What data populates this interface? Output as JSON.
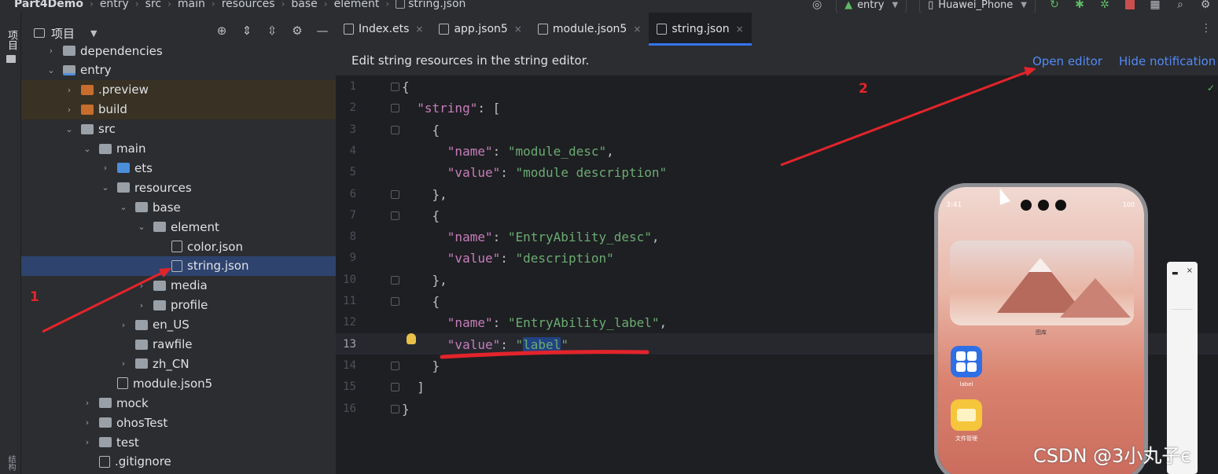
{
  "breadcrumbs": [
    "Part4Demo",
    "entry",
    "src",
    "main",
    "resources",
    "base",
    "element",
    "string.json"
  ],
  "toolbar": {
    "module_combo": "entry",
    "device_combo": "Huawei_Phone"
  },
  "left_strip": {
    "project_label": "项目",
    "bottom_label": "结构"
  },
  "project_panel": {
    "title": "项目",
    "tree": [
      {
        "label": "dependencies",
        "arrow": "›",
        "depth": 1,
        "icon": "grey"
      },
      {
        "label": "entry",
        "arrow": "⌄",
        "depth": 1,
        "icon": "grey-mod"
      },
      {
        "label": ".preview",
        "arrow": "›",
        "depth": 2,
        "icon": "orange"
      },
      {
        "label": "build",
        "arrow": "›",
        "depth": 2,
        "icon": "orange"
      },
      {
        "label": "src",
        "arrow": "⌄",
        "depth": 2,
        "icon": "grey"
      },
      {
        "label": "main",
        "arrow": "⌄",
        "depth": 3,
        "icon": "grey"
      },
      {
        "label": "ets",
        "arrow": "›",
        "depth": 4,
        "icon": "blue"
      },
      {
        "label": "resources",
        "arrow": "⌄",
        "depth": 4,
        "icon": "grey"
      },
      {
        "label": "base",
        "arrow": "⌄",
        "depth": 5,
        "icon": "grey"
      },
      {
        "label": "element",
        "arrow": "⌄",
        "depth": 6,
        "icon": "grey"
      },
      {
        "label": "color.json",
        "arrow": "",
        "depth": 7,
        "icon": "file"
      },
      {
        "label": "string.json",
        "arrow": "",
        "depth": 7,
        "icon": "file"
      },
      {
        "label": "media",
        "arrow": "›",
        "depth": 6,
        "icon": "grey"
      },
      {
        "label": "profile",
        "arrow": "›",
        "depth": 6,
        "icon": "grey"
      },
      {
        "label": "en_US",
        "arrow": "›",
        "depth": 5,
        "icon": "grey"
      },
      {
        "label": "rawfile",
        "arrow": "",
        "depth": 5,
        "icon": "grey"
      },
      {
        "label": "zh_CN",
        "arrow": "›",
        "depth": 5,
        "icon": "grey"
      },
      {
        "label": "module.json5",
        "arrow": "",
        "depth": 4,
        "icon": "file"
      },
      {
        "label": "mock",
        "arrow": "›",
        "depth": 3,
        "icon": "grey"
      },
      {
        "label": "ohosTest",
        "arrow": "›",
        "depth": 3,
        "icon": "grey"
      },
      {
        "label": "test",
        "arrow": "›",
        "depth": 3,
        "icon": "grey"
      },
      {
        "label": ".gitignore",
        "arrow": "",
        "depth": 3,
        "icon": "file"
      }
    ],
    "selected_item": "string.json"
  },
  "tabs": [
    {
      "label": "Index.ets",
      "active": false
    },
    {
      "label": "app.json5",
      "active": false
    },
    {
      "label": "module.json5",
      "active": false
    },
    {
      "label": "string.json",
      "active": true
    }
  ],
  "notification": {
    "text": "Edit string resources in the string editor.",
    "open_editor": "Open editor",
    "hide_notification": "Hide notification"
  },
  "code": {
    "current_line": 13,
    "lines": [
      "{",
      "  \"string\": [",
      "    {",
      "      \"name\": \"module_desc\",",
      "      \"value\": \"module description\"",
      "    },",
      "    {",
      "      \"name\": \"EntryAbility_desc\",",
      "      \"value\": \"description\"",
      "    },",
      "    {",
      "      \"name\": \"EntryAbility_label\",",
      "      \"value\": \"label\"",
      "    }",
      "  ]",
      "}"
    ]
  },
  "preview": {
    "time": "3:41",
    "battery": "100",
    "widget_label": "图库",
    "apps": [
      {
        "label": "label",
        "icon": "grid-icon"
      },
      {
        "label": "文件管理",
        "icon": "folder-icon"
      }
    ]
  },
  "annotations": {
    "one": "1",
    "two": "2"
  },
  "watermark": "CSDN @3小丸子є",
  "colors": {
    "accent_link": "#548af7",
    "selection": "#2e436e",
    "annotation_red": "#e3242b",
    "string_green": "#6aab73",
    "key_purple": "#c77dbb"
  }
}
